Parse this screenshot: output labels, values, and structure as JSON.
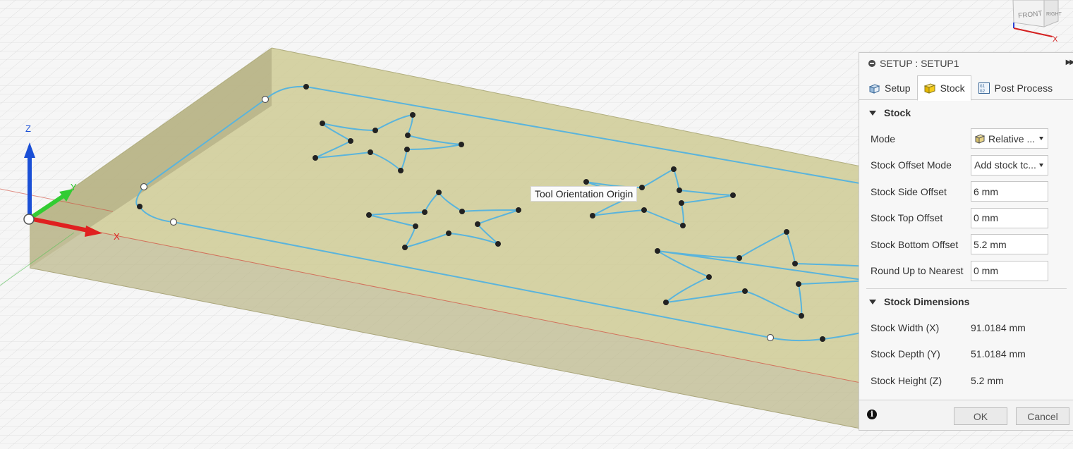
{
  "viewport": {
    "tooltip": "Tool Orientation Origin",
    "axis_labels": {
      "z": "Z",
      "y": "Y",
      "x": "X"
    },
    "view_cube": {
      "front": "FRONT",
      "right": "RIGHT",
      "x_label": "X"
    }
  },
  "panel": {
    "title": "SETUP : SETUP1",
    "tabs": [
      {
        "label": "Setup",
        "icon": "setup-icon"
      },
      {
        "label": "Stock",
        "icon": "stock-cube-icon"
      },
      {
        "label": "Post Process",
        "icon": "post-process-icon"
      }
    ],
    "active_tab": "Stock",
    "stock_section": {
      "title": "Stock",
      "mode_label": "Mode",
      "mode_value": "Relative ...",
      "offset_mode_label": "Stock Offset Mode",
      "offset_mode_value": "Add stock tc...",
      "side_offset_label": "Stock Side Offset",
      "side_offset_value": "6 mm",
      "top_offset_label": "Stock Top Offset",
      "top_offset_value": "0 mm",
      "bottom_offset_label": "Stock Bottom Offset",
      "bottom_offset_value": "5.2 mm",
      "round_label": "Round Up to Nearest",
      "round_value": "0 mm"
    },
    "dimensions_section": {
      "title": "Stock Dimensions",
      "width_label": "Stock Width (X)",
      "width_value": "91.0184 mm",
      "depth_label": "Stock Depth (Y)",
      "depth_value": "51.0184 mm",
      "height_label": "Stock Height (Z)",
      "height_value": "5.2 mm"
    },
    "footer": {
      "ok": "OK",
      "cancel": "Cancel"
    }
  },
  "colors": {
    "stock": "#c9c48a",
    "sketch": "#5ab4dc",
    "x_axis": "#e02020",
    "y_axis": "#33cc33",
    "z_axis": "#1a4fd6"
  }
}
